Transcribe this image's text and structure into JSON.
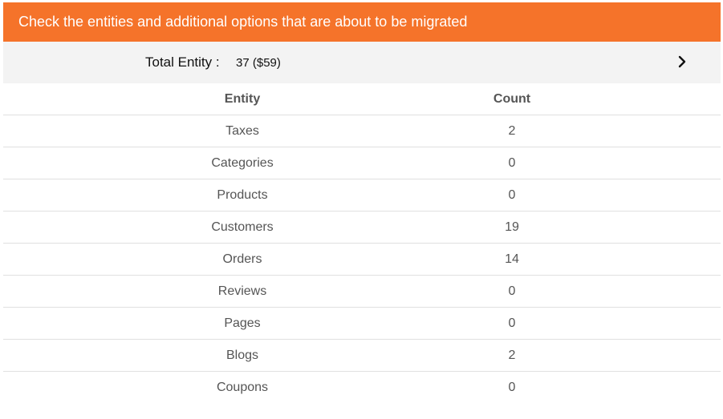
{
  "header": {
    "title": "Check the entities and additional options that are about to be migrated"
  },
  "summary": {
    "label": "Total Entity :",
    "value": "37 ($59)",
    "expand_icon": "chevron-right-icon"
  },
  "table": {
    "columns": [
      "Entity",
      "Count"
    ],
    "rows": [
      {
        "entity": "Taxes",
        "count": "2"
      },
      {
        "entity": "Categories",
        "count": "0"
      },
      {
        "entity": "Products",
        "count": "0"
      },
      {
        "entity": "Customers",
        "count": "19"
      },
      {
        "entity": "Orders",
        "count": "14"
      },
      {
        "entity": "Reviews",
        "count": "0"
      },
      {
        "entity": "Pages",
        "count": "0"
      },
      {
        "entity": "Blogs",
        "count": "2"
      },
      {
        "entity": "Coupons",
        "count": "0"
      }
    ]
  },
  "colors": {
    "header_bg": "#f5732a",
    "summary_bg": "#f3f3f3"
  }
}
